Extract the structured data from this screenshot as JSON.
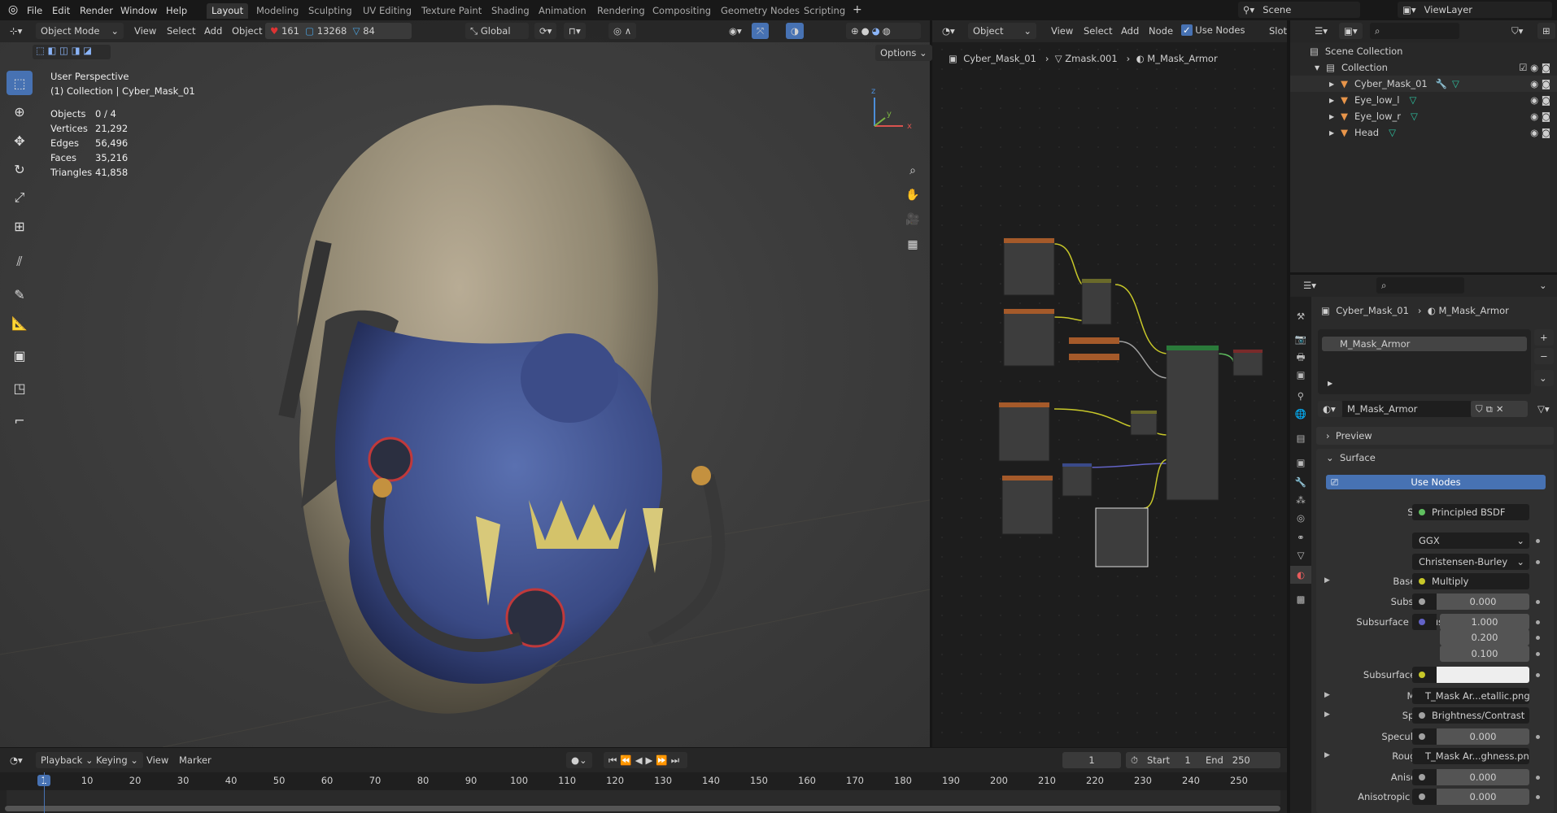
{
  "menu": {
    "items": [
      "File",
      "Edit",
      "Render",
      "Window",
      "Help"
    ]
  },
  "workspaces": [
    "Layout",
    "Modeling",
    "Sculpting",
    "UV Editing",
    "Texture Paint",
    "Shading",
    "Animation",
    "Rendering",
    "Compositing",
    "Geometry Nodes",
    "Scripting"
  ],
  "scene": {
    "name": "Scene",
    "view_layer": "ViewLayer"
  },
  "viewport": {
    "mode": "Object Mode",
    "menus": [
      "View",
      "Select",
      "Add",
      "Object"
    ],
    "counts": {
      "a": "161",
      "b": "13268",
      "c": "84"
    },
    "orientation": "Global",
    "options": "Options",
    "overlay_title": "User Perspective",
    "overlay_sub": "(1) Collection | Cyber_Mask_01",
    "stats": [
      [
        "Objects",
        "0 / 4"
      ],
      [
        "Vertices",
        "21,292"
      ],
      [
        "Edges",
        "56,496"
      ],
      [
        "Faces",
        "35,216"
      ],
      [
        "Triangles",
        "41,858"
      ]
    ]
  },
  "node_editor": {
    "type": "Object",
    "menus": [
      "View",
      "Select",
      "Add",
      "Node"
    ],
    "use_nodes": "Use Nodes",
    "slot": "Slot",
    "breadcrumb": [
      "Cyber_Mask_01",
      "Zmask.001",
      "M_Mask_Armor"
    ]
  },
  "outliner": {
    "rows": [
      {
        "label": "Scene Collection"
      },
      {
        "label": "Collection"
      },
      {
        "label": "Cyber_Mask_01"
      },
      {
        "label": "Eye_low_l"
      },
      {
        "label": "Eye_low_r"
      },
      {
        "label": "Head"
      }
    ]
  },
  "properties": {
    "breadcrumb": [
      "Cyber_Mask_01",
      "M_Mask_Armor"
    ],
    "slot": "M_Mask_Armor",
    "material": "M_Mask_Armor",
    "preview": "Preview",
    "surface_panel": "Surface",
    "use_nodes": "Use Nodes",
    "rows": [
      {
        "label": "Surface",
        "value": "Principled BSDF",
        "socket": "#5fbf5f",
        "kind": "link"
      },
      {
        "label": "",
        "value": "GGX",
        "kind": "enum"
      },
      {
        "label": "",
        "value": "Christensen-Burley",
        "kind": "enum"
      },
      {
        "label": "Base Color",
        "value": "Multiply",
        "socket": "#c7c729",
        "kind": "link",
        "expand": true
      },
      {
        "label": "Subsurface",
        "value": "0.000",
        "socket": "#a1a1a1",
        "kind": "num"
      },
      {
        "label": "Subsurface Radius",
        "value": "1.000",
        "socket": "#6363c7",
        "kind": "num"
      },
      {
        "label": "",
        "value": "0.200",
        "kind": "num2"
      },
      {
        "label": "",
        "value": "0.100",
        "kind": "num2"
      },
      {
        "label": "Subsurface Color",
        "value": "",
        "socket": "#c7c729",
        "kind": "color"
      },
      {
        "label": "Metallic",
        "value": "T_Mask Ar...etallic.png",
        "socket": "#a1a1a1",
        "kind": "link",
        "expand": true
      },
      {
        "label": "Specular",
        "value": "Brightness/Contrast",
        "socket": "#a1a1a1",
        "kind": "link",
        "expand": true
      },
      {
        "label": "Specular Tint",
        "value": "0.000",
        "socket": "#a1a1a1",
        "kind": "num"
      },
      {
        "label": "Roughness",
        "value": "T_Mask Ar...ghness.png",
        "socket": "#a1a1a1",
        "kind": "link",
        "expand": true
      },
      {
        "label": "Anisotropic",
        "value": "0.000",
        "socket": "#a1a1a1",
        "kind": "num"
      },
      {
        "label": "Anisotropic Rota...",
        "value": "0.000",
        "socket": "#a1a1a1",
        "kind": "num"
      }
    ]
  },
  "timeline": {
    "menus": [
      "Playback",
      "Keying",
      "View",
      "Marker"
    ],
    "current_frame": "1",
    "start_label": "Start",
    "start": "1",
    "end_label": "End",
    "end": "250",
    "ticks": [
      "1",
      "10",
      "20",
      "30",
      "40",
      "50",
      "60",
      "70",
      "80",
      "90",
      "100",
      "110",
      "120",
      "130",
      "140",
      "150",
      "160",
      "170",
      "180",
      "190",
      "200",
      "210",
      "220",
      "230",
      "240",
      "250"
    ]
  },
  "colors": {
    "accent": "#4772b3",
    "mesh": "#e8954a",
    "modifier": "#5c8ad6",
    "data": "#2ec2a0"
  }
}
